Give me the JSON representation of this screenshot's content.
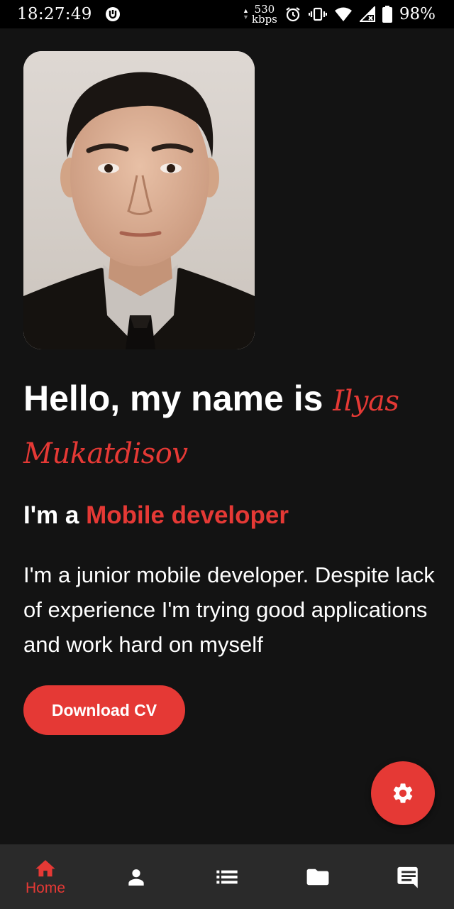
{
  "status_bar": {
    "time": "18:27:49",
    "speed_value": "530",
    "speed_unit": "kbps",
    "battery": "98%"
  },
  "profile": {
    "photo_alt": "profile-photo",
    "greeting": "Hello, my name is ",
    "name": "Ilyas Mukatdisov",
    "role_prefix": "I'm a ",
    "role": "Mobile developer",
    "bio": "I'm a junior mobile developer. Despite lack of experience I'm trying good applications and work hard on myself",
    "download_label": "Download CV"
  },
  "fab": {
    "icon": "gear-icon"
  },
  "bottom_nav": {
    "items": [
      {
        "id": "home",
        "label": "Home",
        "icon": "home-icon",
        "active": true
      },
      {
        "id": "about",
        "label": "",
        "icon": "person-icon",
        "active": false
      },
      {
        "id": "skills",
        "label": "",
        "icon": "list-icon",
        "active": false
      },
      {
        "id": "projects",
        "label": "",
        "icon": "folder-icon",
        "active": false
      },
      {
        "id": "contact",
        "label": "",
        "icon": "message-icon",
        "active": false
      }
    ]
  },
  "colors": {
    "accent": "#e53935",
    "background": "#131313",
    "nav_background": "#2a2a2a",
    "status_background": "#000000"
  }
}
